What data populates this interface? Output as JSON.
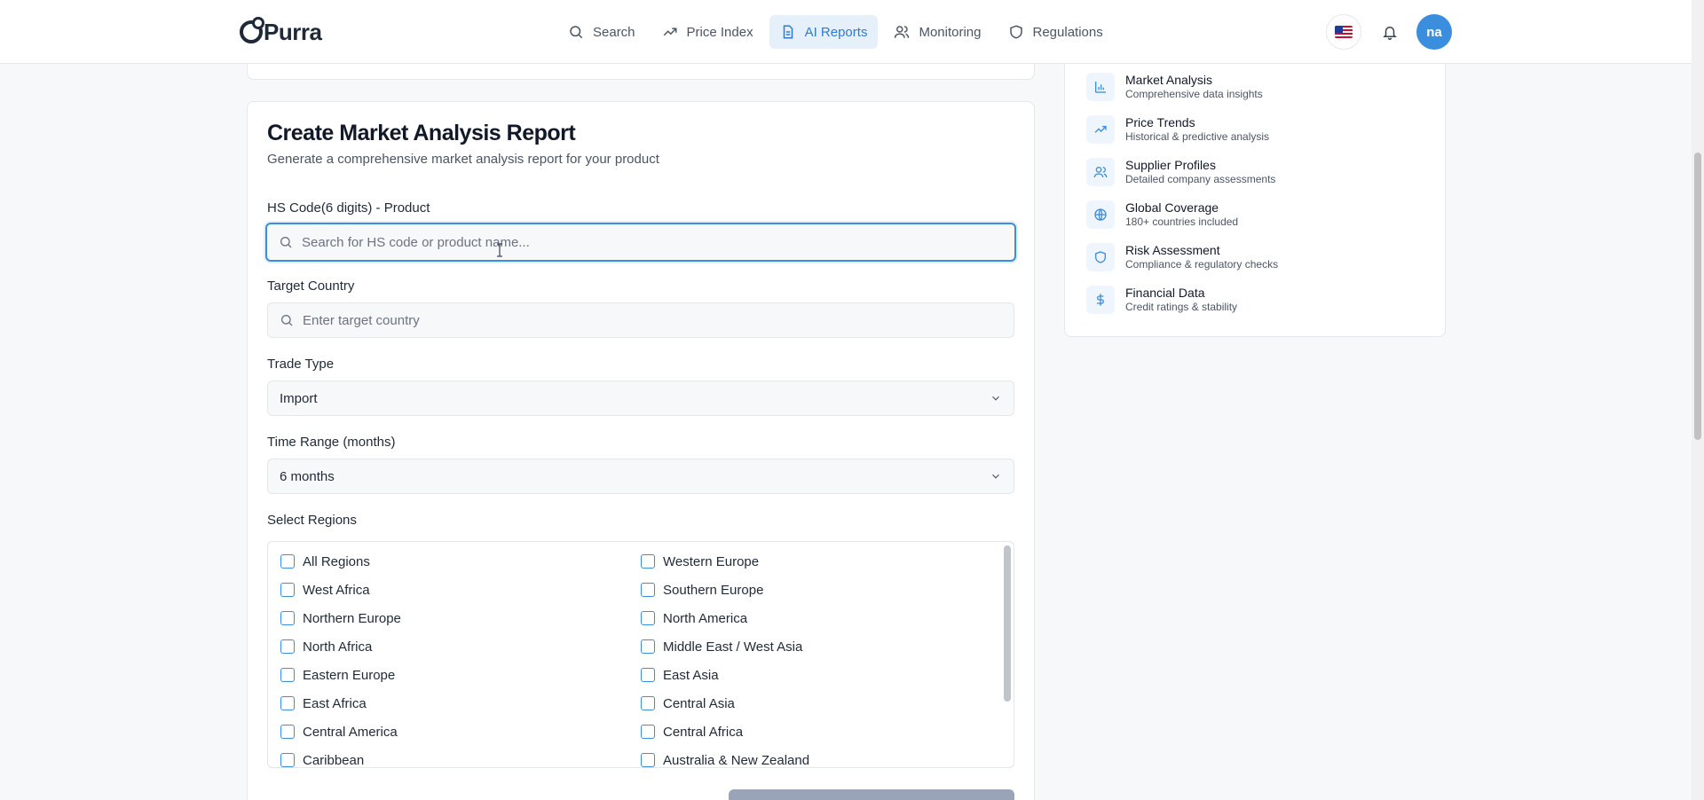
{
  "brand": {
    "name": "Purra"
  },
  "nav": [
    {
      "label": "Search",
      "icon": "search-icon",
      "active": false
    },
    {
      "label": "Price Index",
      "icon": "trending-up-icon",
      "active": false
    },
    {
      "label": "AI Reports",
      "icon": "document-icon",
      "active": true
    },
    {
      "label": "Monitoring",
      "icon": "users-icon",
      "active": false
    },
    {
      "label": "Regulations",
      "icon": "shield-icon",
      "active": false
    }
  ],
  "header": {
    "avatar_initials": "na"
  },
  "form": {
    "title": "Create Market Analysis Report",
    "subtitle": "Generate a comprehensive market analysis report for your product",
    "hs_code": {
      "label": "HS Code(6 digits) - Product",
      "placeholder": "Search for HS code or product name...",
      "value": ""
    },
    "country": {
      "label": "Target Country",
      "placeholder": "Enter target country",
      "value": ""
    },
    "trade_type": {
      "label": "Trade Type",
      "value": "Import"
    },
    "time_range": {
      "label": "Time Range (months)",
      "value": "6 months"
    },
    "regions": {
      "label": "Select Regions",
      "items": [
        "All Regions",
        "Western Europe",
        "West Africa",
        "Southern Europe",
        "Northern Europe",
        "North America",
        "North Africa",
        "Middle East / West Asia",
        "Eastern Europe",
        "East Asia",
        "East Africa",
        "Central Asia",
        "Central America",
        "Central Africa",
        "Caribbean",
        "Australia & New Zealand"
      ]
    }
  },
  "features": [
    {
      "title": "Market Analysis",
      "desc": "Comprehensive data insights",
      "icon": "bar-chart-icon"
    },
    {
      "title": "Price Trends",
      "desc": "Historical & predictive analysis",
      "icon": "trending-up-icon"
    },
    {
      "title": "Supplier Profiles",
      "desc": "Detailed company assessments",
      "icon": "users-icon"
    },
    {
      "title": "Global Coverage",
      "desc": "180+ countries included",
      "icon": "globe-icon"
    },
    {
      "title": "Risk Assessment",
      "desc": "Compliance & regulatory checks",
      "icon": "shield-icon"
    },
    {
      "title": "Financial Data",
      "desc": "Credit ratings & stability",
      "icon": "dollar-icon"
    }
  ],
  "colors": {
    "accent": "#3b8ddd",
    "active_nav_bg": "#e6f0fb",
    "icon_bg": "#eef5fc"
  }
}
